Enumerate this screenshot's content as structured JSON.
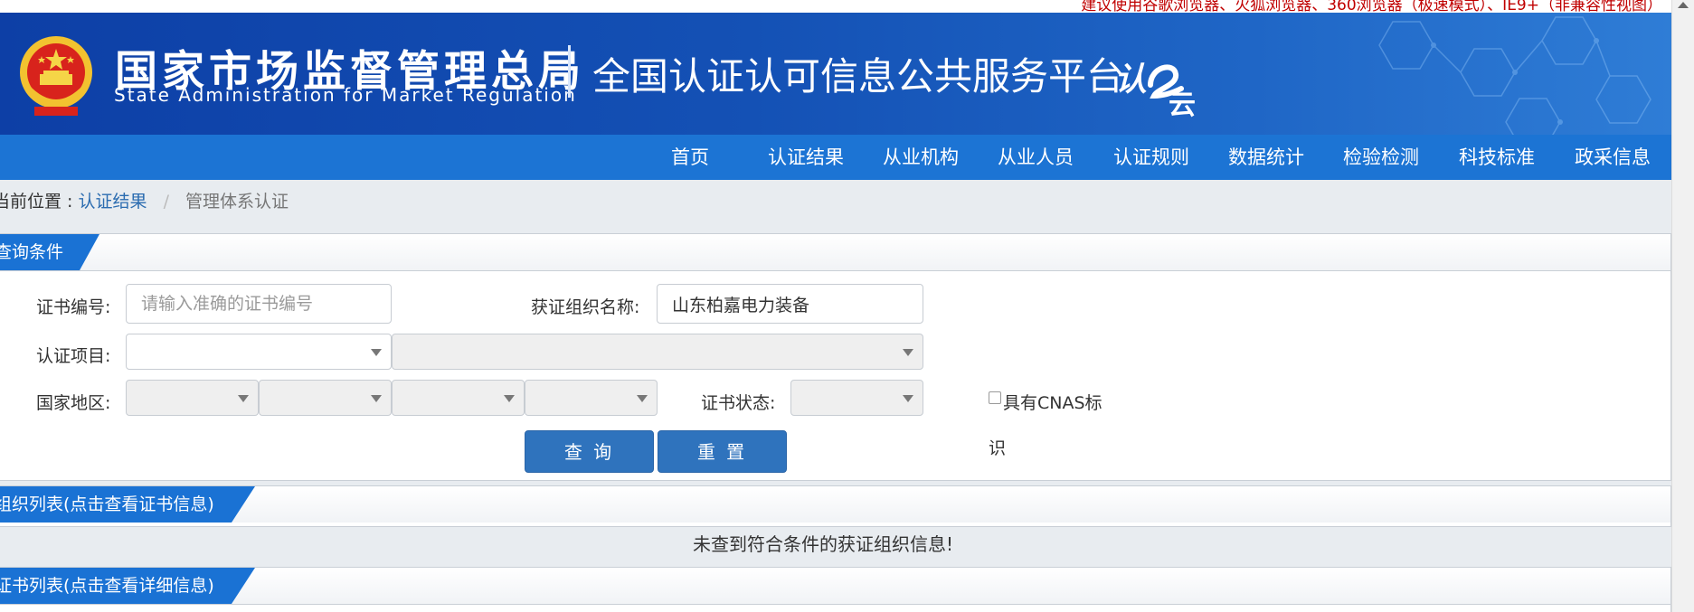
{
  "top_notice": "建议使用谷歌浏览器、火狐浏览器、360浏览器（极速模式）、IE9+（非兼容性视图）",
  "header": {
    "agency_cn": "国家市场监督管理总局",
    "agency_en": "State Administration  for  Market Regulation",
    "platform_title": "全国认证认可信息公共服务平台",
    "brand_logo": "认e云"
  },
  "nav": {
    "items": [
      "首页",
      "认证结果",
      "从业机构",
      "从业人员",
      "认证规则",
      "数据统计",
      "检验检测",
      "科技标准",
      "政采信息"
    ]
  },
  "breadcrumb": {
    "prefix": "当前位置 :",
    "link": "认证结果",
    "current": "管理体系认证"
  },
  "query": {
    "section_title": "查询条件",
    "cert_no_label": "证书编号:",
    "cert_no_placeholder": "请输入准确的证书编号",
    "cert_no_value": "",
    "org_name_label": "获证组织名称:",
    "org_name_value": "山东柏嘉电力装备",
    "project_label": "认证项目:",
    "region_label": "国家地区:",
    "status_label": "证书状态:",
    "cnas_label_1": "具有CNAS标",
    "cnas_label_2": "识",
    "search_button": "查 询",
    "reset_button": "重 置"
  },
  "org_list": {
    "section_title": "组织列表(点击查看证书信息)",
    "empty_message": "未查到符合条件的获证组织信息!"
  },
  "cert_list": {
    "section_title": "证书列表(点击查看详细信息)"
  }
}
